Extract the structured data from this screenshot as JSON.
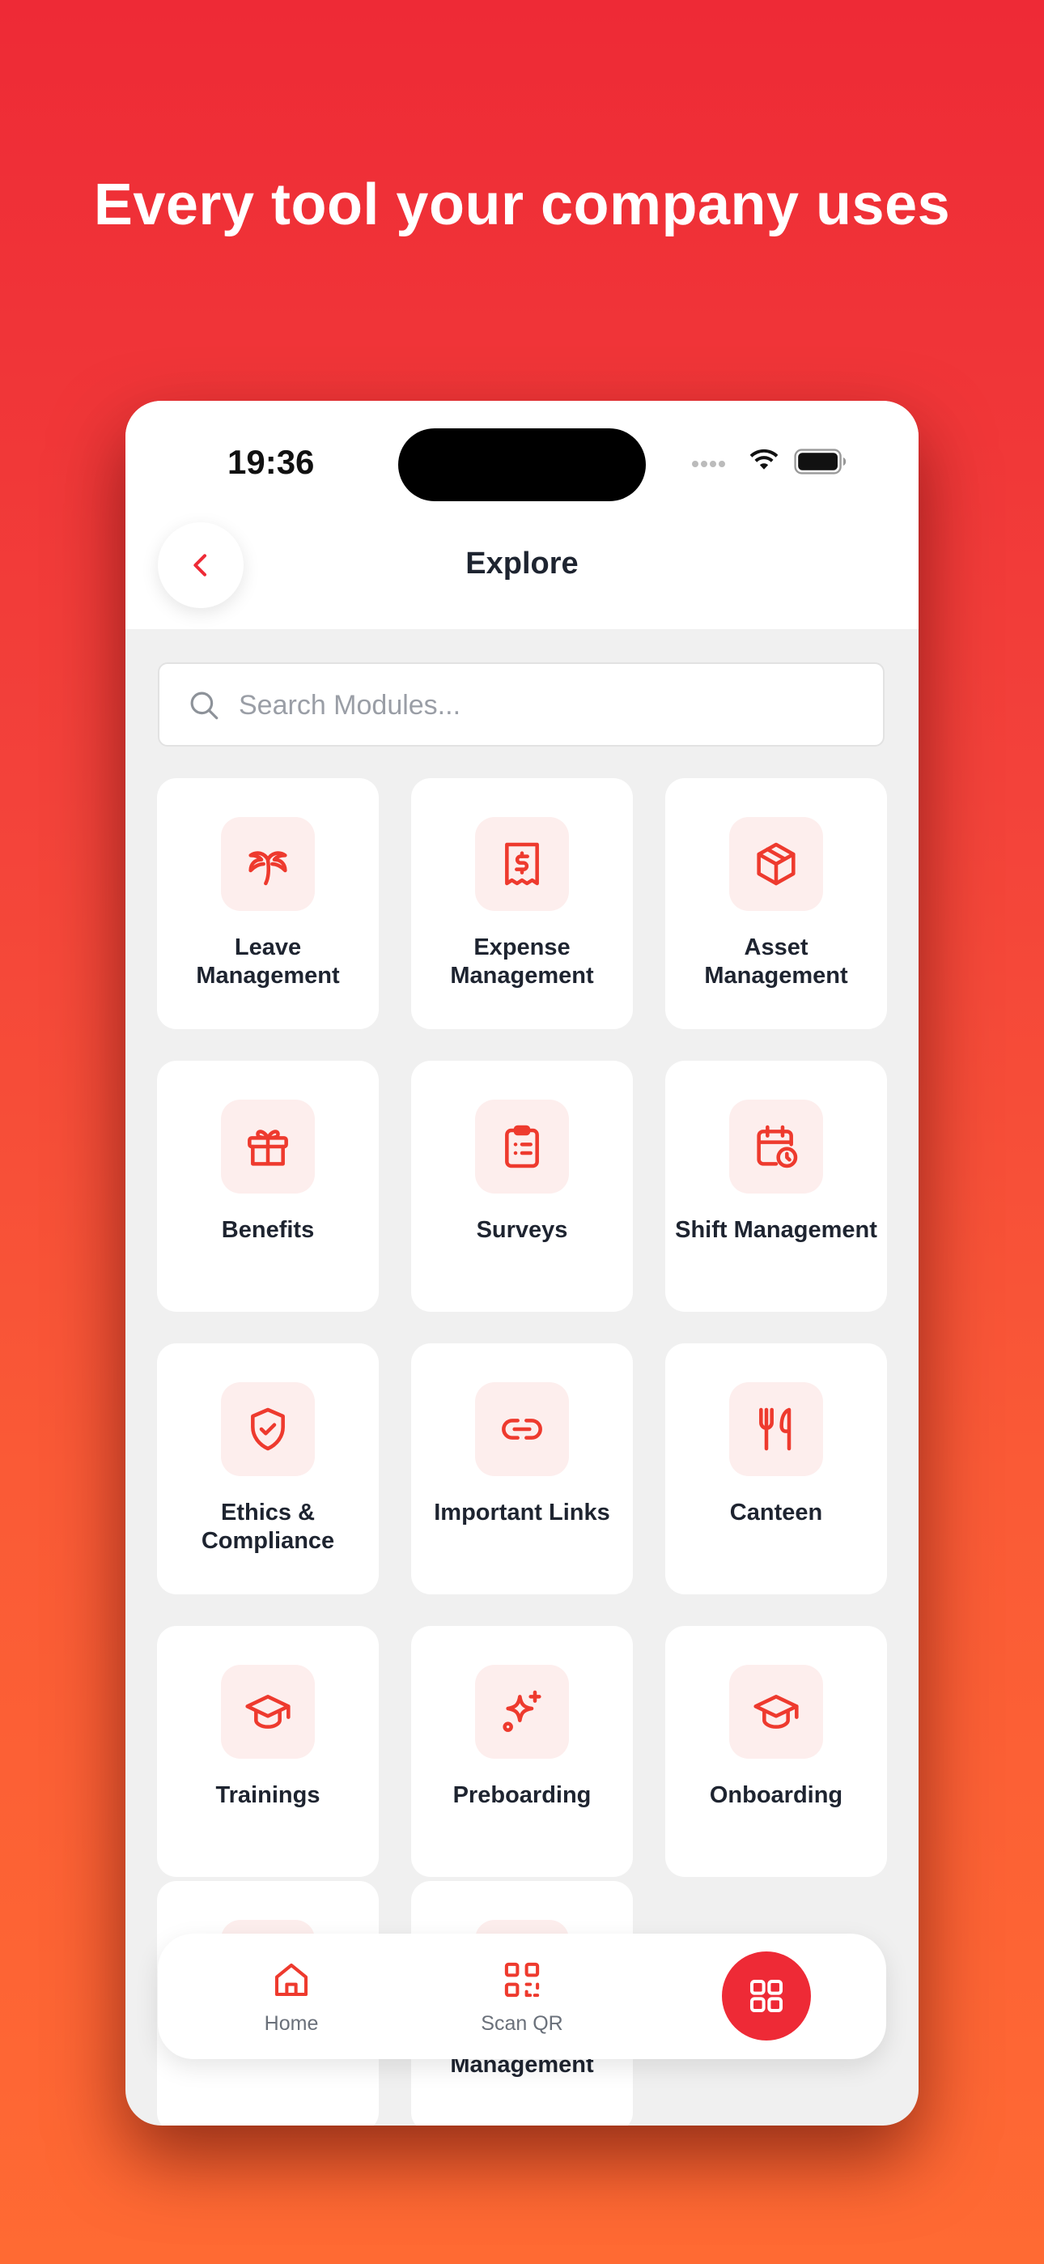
{
  "headline": "Every tool your company uses",
  "status_bar": {
    "time": "19:36"
  },
  "header": {
    "title": "Explore"
  },
  "search": {
    "placeholder": "Search Modules..."
  },
  "colors": {
    "accent": "#ee2a36",
    "icon_bg": "#fdeeed",
    "text": "#1e2430"
  },
  "modules": [
    {
      "label": "Leave Management",
      "icon": "palm-tree-icon"
    },
    {
      "label": "Expense Management",
      "icon": "receipt-dollar-icon"
    },
    {
      "label": "Asset Management",
      "icon": "box-icon"
    },
    {
      "label": "Benefits",
      "icon": "gift-icon"
    },
    {
      "label": "Surveys",
      "icon": "clipboard-list-icon"
    },
    {
      "label": "Shift Management",
      "icon": "calendar-clock-icon"
    },
    {
      "label": "Ethics & Compliance",
      "icon": "shield-check-icon"
    },
    {
      "label": "Important Links",
      "icon": "link-icon"
    },
    {
      "label": "Canteen",
      "icon": "fork-knife-icon"
    },
    {
      "label": "Trainings",
      "icon": "graduation-cap-icon"
    },
    {
      "label": "Preboarding",
      "icon": "sparkle-icon"
    },
    {
      "label": "Onboarding",
      "icon": "graduation-cap-icon"
    },
    {
      "label": "",
      "icon": ""
    },
    {
      "label": "Management",
      "icon": ""
    }
  ],
  "tabbar": {
    "home_label": "Home",
    "scan_label": "Scan QR",
    "apps_icon": "grid-icon"
  }
}
